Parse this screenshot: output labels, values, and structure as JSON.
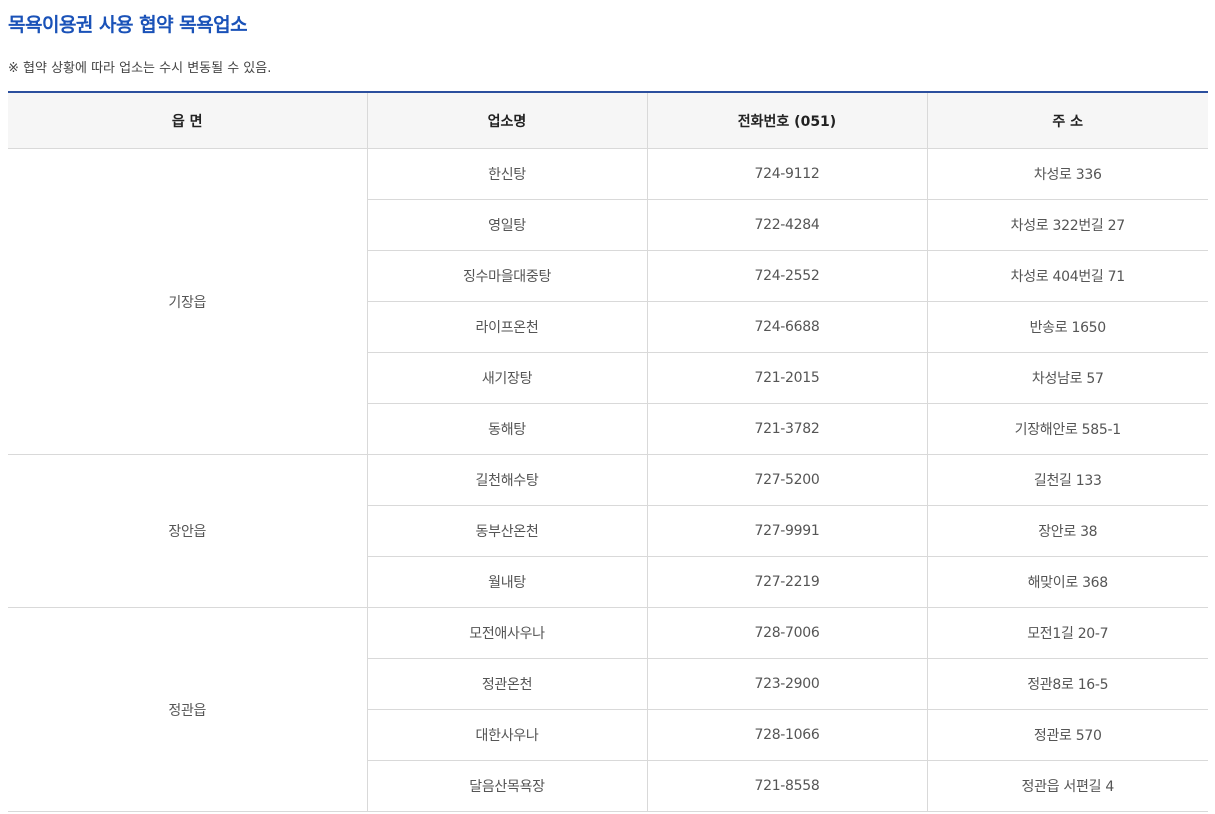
{
  "title": "목욕이용권 사용 협약 목욕업소",
  "note": "※ 협약 상황에 따라 업소는 수시 변동될 수 있음.",
  "table": {
    "headers": [
      "읍 면",
      "업소명",
      "전화번호 (051)",
      "주 소"
    ],
    "groups": [
      {
        "region": "기장읍",
        "rows": [
          [
            "한신탕",
            "724-9112",
            "차성로 336"
          ],
          [
            "영일탕",
            "722-4284",
            "차성로 322번길 27"
          ],
          [
            "징수마을대중탕",
            "724-2552",
            "차성로 404번길 71"
          ],
          [
            "라이프온천",
            "724-6688",
            "반송로 1650"
          ],
          [
            "새기장탕",
            "721-2015",
            "차성남로 57"
          ],
          [
            "동해탕",
            "721-3782",
            "기장해안로 585-1"
          ]
        ]
      },
      {
        "region": "장안읍",
        "rows": [
          [
            "길천해수탕",
            "727-5200",
            "길천길 133"
          ],
          [
            "동부산온천",
            "727-9991",
            "장안로 38"
          ],
          [
            "월내탕",
            "727-2219",
            "해맞이로 368"
          ]
        ]
      },
      {
        "region": "정관읍",
        "rows": [
          [
            "모전애사우나",
            "728-7006",
            "모전1길 20-7"
          ],
          [
            "정관온천",
            "723-2900",
            "정관8로 16-5"
          ],
          [
            "대한사우나",
            "728-1066",
            "정관로 570"
          ],
          [
            "달음산목욕장",
            "721-8558",
            "정관읍 서편길 4"
          ]
        ]
      }
    ]
  }
}
